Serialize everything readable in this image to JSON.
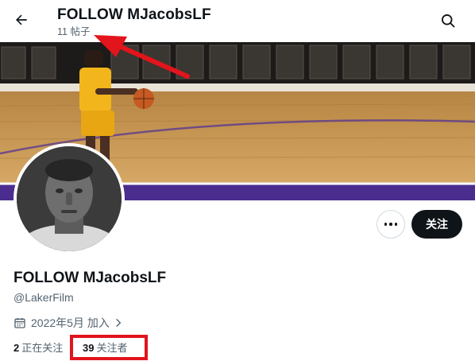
{
  "header": {
    "back_icon": "arrow-left-icon",
    "title": "FOLLOW MJacobsLF",
    "post_count": "11 帖子",
    "search_icon": "search-icon"
  },
  "profile": {
    "display_name": "FOLLOW MJacobsLF",
    "handle": "@LakerFilm",
    "joined": "2022年5月 加入",
    "following_count": "2",
    "following_label": "正在关注",
    "followers_count": "39",
    "followers_label": "关注者"
  },
  "actions": {
    "more_icon": "more-horizontal-icon",
    "follow_label": "关注"
  },
  "colors": {
    "text_primary": "#0f1419",
    "text_secondary": "#536471",
    "annotation_red": "#e2141c",
    "court_purple": "#4b2d8f",
    "court_wood": "#c9974f"
  }
}
